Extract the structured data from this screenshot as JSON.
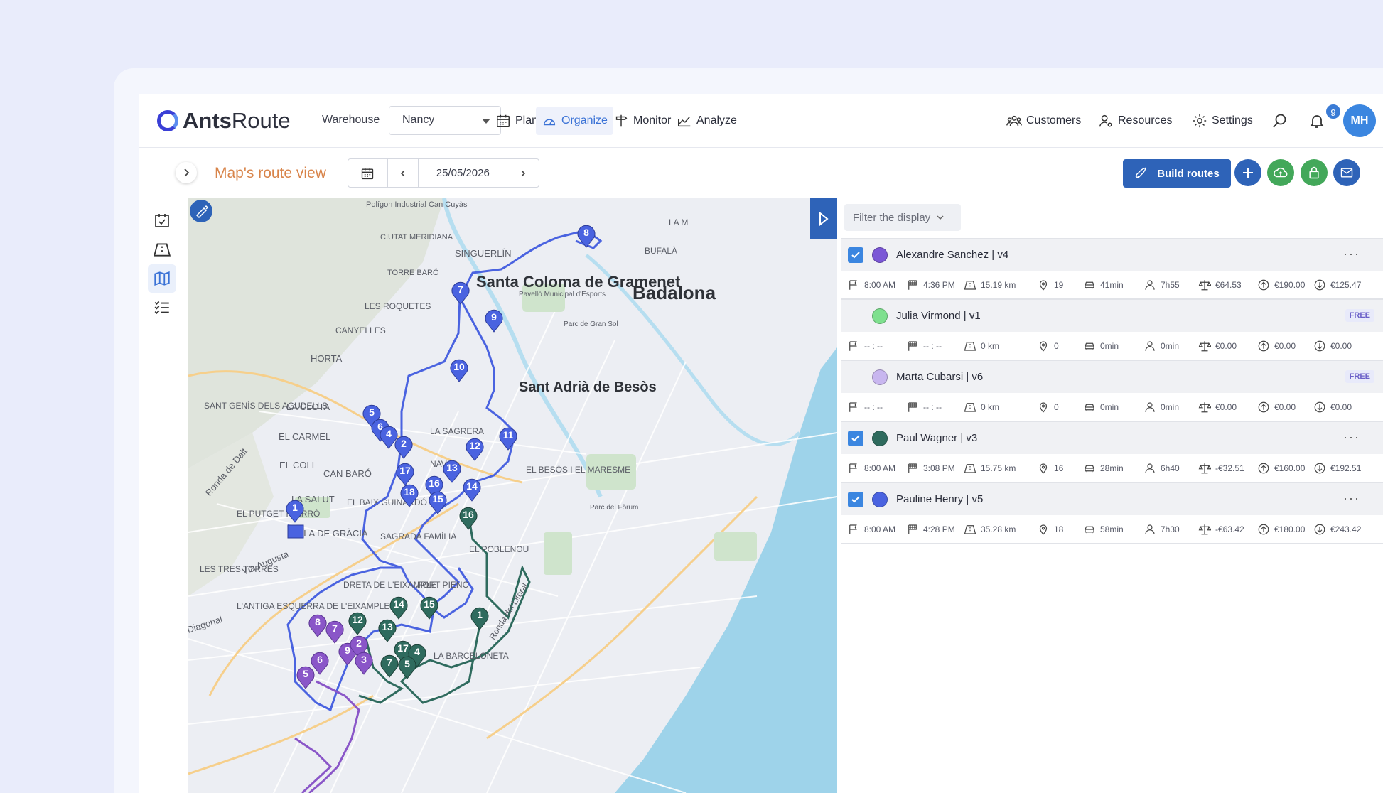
{
  "app": {
    "brand_a": "Ants",
    "brand_b": "Route"
  },
  "header": {
    "warehouse_label": "Warehouse",
    "warehouse_value": "Nancy",
    "nav": {
      "plan": "Plan",
      "organize": "Organize",
      "monitor": "Monitor",
      "analyze": "Analyze"
    },
    "right": {
      "customers": "Customers",
      "resources": "Resources",
      "settings": "Settings"
    },
    "notifications_count": "9",
    "avatar_initials": "MH"
  },
  "toolbar": {
    "title": "Map's route view",
    "date": "25/05/2026",
    "build_routes": "Build routes"
  },
  "panel": {
    "filter_label": "Filter the display",
    "routes": [
      {
        "name": "Alexandre Sanchez | v4",
        "color": "#7b57d6",
        "checked": true,
        "free": "",
        "start": "8:00 AM",
        "end": "4:36 PM",
        "distance": "15.19 km",
        "stops": "19",
        "drive": "41min",
        "work": "7h55",
        "margin": "€64.53",
        "revenue": "€190.00",
        "cost": "€125.47"
      },
      {
        "name": "Julia Virmond | v1",
        "color": "#7ee08e",
        "checked": false,
        "free": "FREE",
        "start": "-- : --",
        "end": "-- : --",
        "distance": "0 km",
        "stops": "0",
        "drive": "0min",
        "work": "0min",
        "margin": "€0.00",
        "revenue": "€0.00",
        "cost": "€0.00"
      },
      {
        "name": "Marta Cubarsi | v6",
        "color": "#c8b6ef",
        "checked": false,
        "free": "FREE",
        "start": "-- : --",
        "end": "-- : --",
        "distance": "0 km",
        "stops": "0",
        "drive": "0min",
        "work": "0min",
        "margin": "€0.00",
        "revenue": "€0.00",
        "cost": "€0.00"
      },
      {
        "name": "Paul Wagner | v3",
        "color": "#2f6b5e",
        "checked": true,
        "free": "",
        "start": "8:00 AM",
        "end": "3:08 PM",
        "distance": "15.75 km",
        "stops": "16",
        "drive": "28min",
        "work": "6h40",
        "margin": "-€32.51",
        "revenue": "€160.00",
        "cost": "€192.51"
      },
      {
        "name": "Pauline Henry | v5",
        "color": "#4a63e0",
        "checked": true,
        "free": "",
        "start": "8:00 AM",
        "end": "4:28 PM",
        "distance": "35.28 km",
        "stops": "18",
        "drive": "58min",
        "work": "7h30",
        "margin": "-€63.42",
        "revenue": "€180.00",
        "cost": "€243.42"
      }
    ]
  },
  "map": {
    "labels": [
      "Polígon Industrial Can Cuyàs",
      "CIUTAT MERIDIANA",
      "SINGUERLÍN",
      "TORRE BARÓ",
      "Santa Coloma de Gramenet",
      "Badalona",
      "LES ROQUETES",
      "CANYELLES",
      "HORTA",
      "Sant Adrià de Besòs",
      "SANT GENÍS DELS AGUDELLS",
      "LA CLOTA",
      "EL CARMEL",
      "EL COLL",
      "LA SAGRERA",
      "NAVAS",
      "CAN BARÓ",
      "EL BESÒS I EL MARESME",
      "LA SALUT",
      "EL BAIX GUINARDÓ",
      "EL PUTGET I FARRÓ",
      "VILA DE GRÀCIA",
      "SAGRADA FAMÍLIA",
      "EL POBLENOU",
      "LES TRES TORRES",
      "Via Augusta",
      "DRETA DE L'EIXAMPLE",
      "FORT PIENC",
      "L'ANTIGA ESQUERRA DE L'EIXAMPLE",
      "LA BARCELONETA",
      "BUFALÀ",
      "LA M",
      "Ronda de Dalt",
      "Ronda del Litoral",
      "Diagonal",
      "Parc del Fòrum",
      "Pavelló Municipal d'Esports",
      "Parc de Gran Sol"
    ],
    "blue_markers": [
      "8",
      "7",
      "9",
      "10",
      "5",
      "6",
      "4",
      "2",
      "11",
      "12",
      "13",
      "17",
      "16",
      "18",
      "15",
      "14",
      "1"
    ],
    "green_markers": [
      "16",
      "1",
      "14",
      "15",
      "12",
      "13",
      "17",
      "4",
      "7",
      "5"
    ],
    "purple_markers": [
      "8",
      "7",
      "9",
      "2",
      "6",
      "3",
      "5"
    ]
  },
  "icons": [
    "search-icon",
    "bell-icon",
    "calendar-icon",
    "rocket-icon",
    "plus-icon",
    "cloud-icon",
    "lock-icon",
    "mail-icon"
  ]
}
